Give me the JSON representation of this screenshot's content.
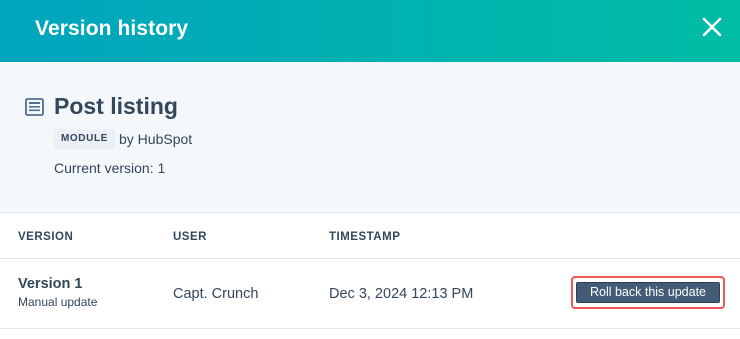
{
  "header": {
    "title": "Version history",
    "close_icon": "close-icon"
  },
  "item": {
    "icon": "document-icon",
    "title": "Post listing",
    "type_tag": "MODULE",
    "byline": "by HubSpot",
    "current_version": "Current version: 1"
  },
  "table": {
    "columns": [
      "VERSION",
      "USER",
      "TIMESTAMP"
    ],
    "rows": [
      {
        "version": "Version 1",
        "note": "Manual update",
        "user": "Capt. Crunch",
        "timestamp": "Dec 3, 2024 12:13 PM",
        "action_label": "Roll back this update"
      }
    ]
  },
  "colors": {
    "header_start": "#00a4bd",
    "header_end": "#00bda5",
    "text": "#33475b",
    "button": "#425b76",
    "highlight": "#f2545b"
  }
}
